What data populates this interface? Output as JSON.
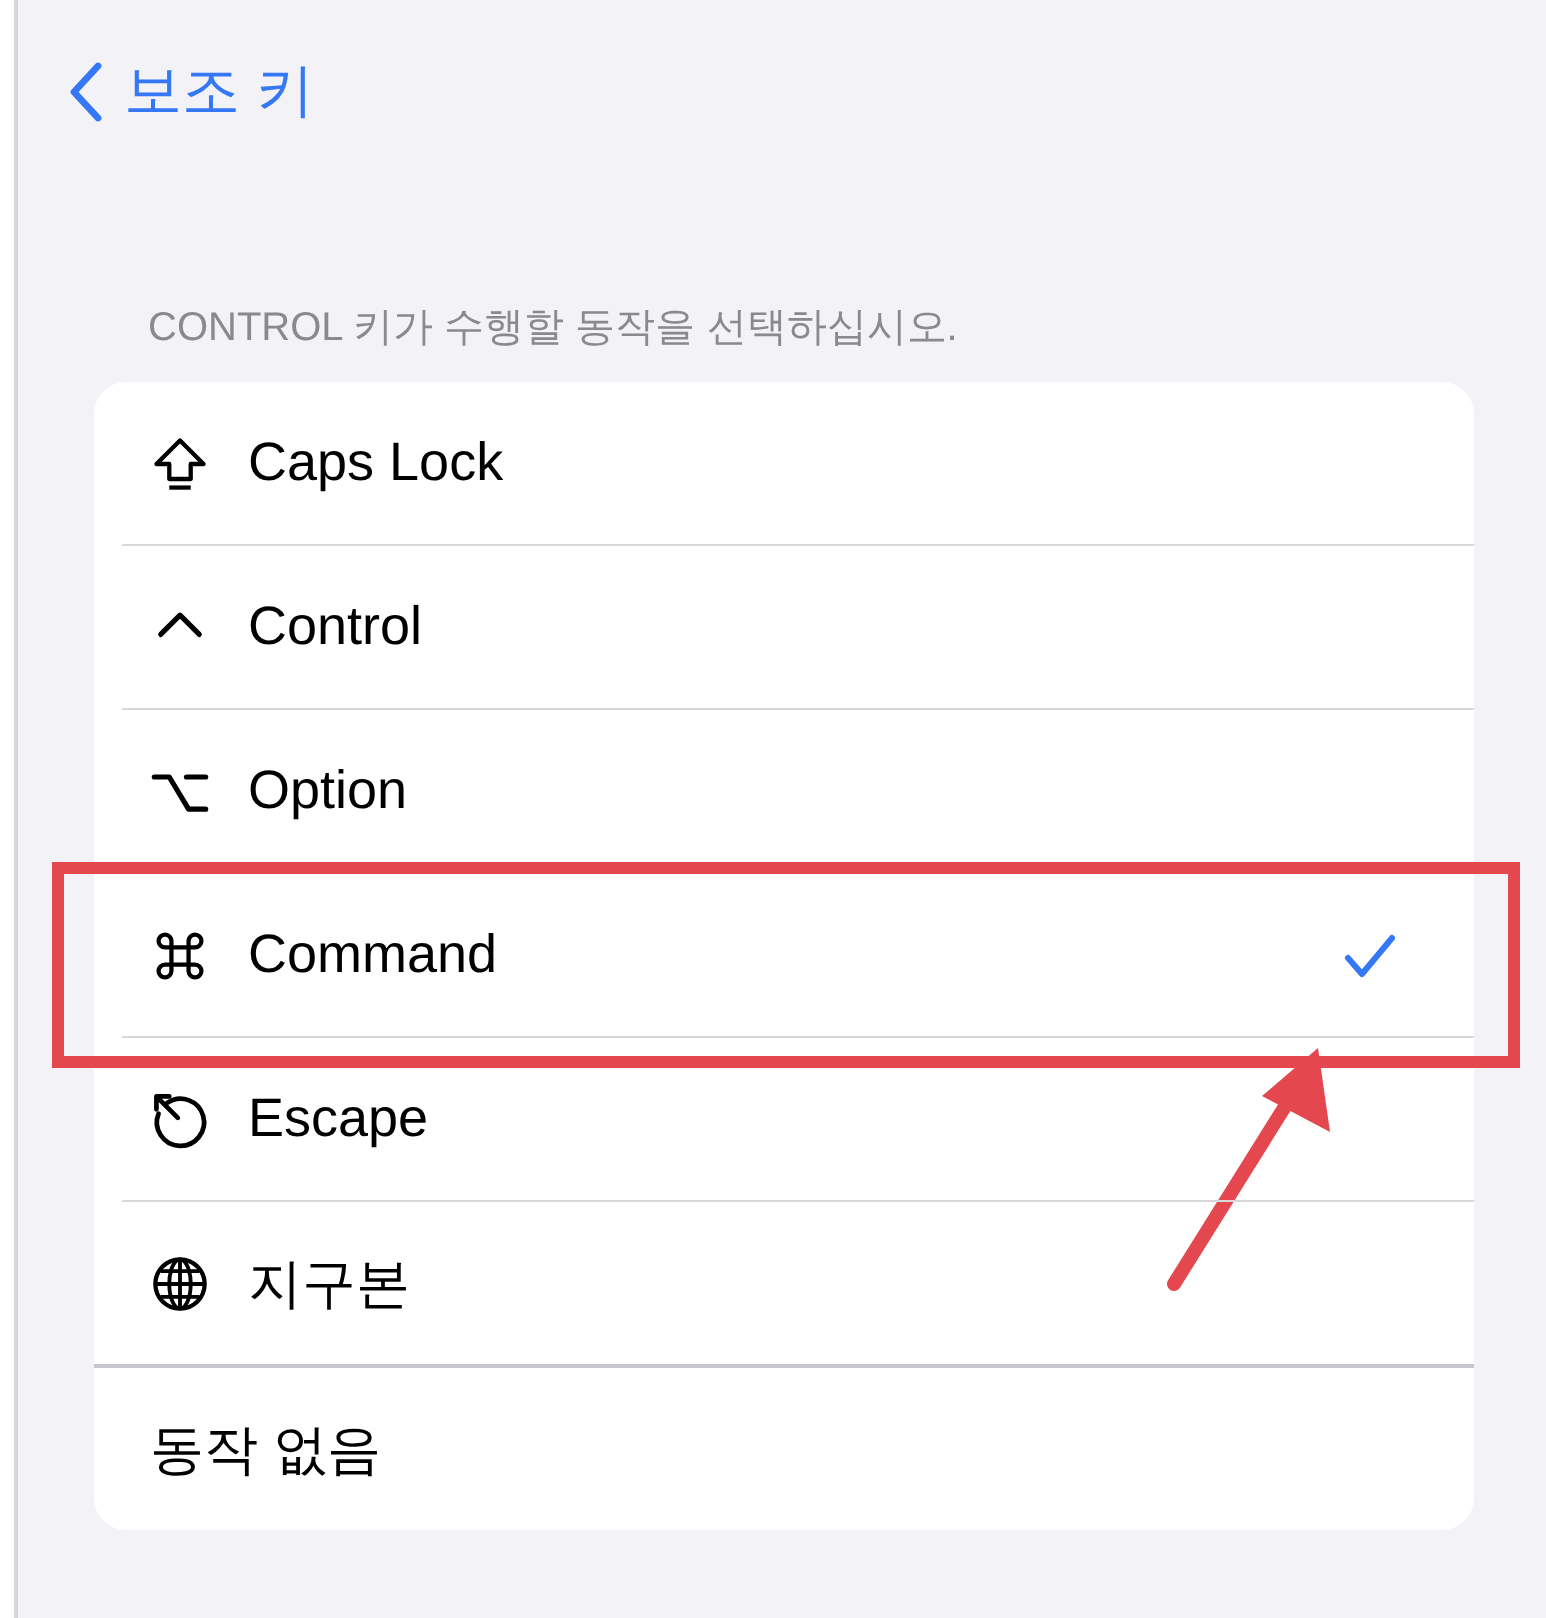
{
  "nav": {
    "back_label": "보조 키"
  },
  "section_header": "CONTROL 키가 수행할 동작을 선택하십시오.",
  "options": [
    {
      "label": "Caps Lock",
      "kind": "key",
      "selected": false,
      "highlighted": false
    },
    {
      "label": "Control",
      "kind": "key",
      "selected": false,
      "highlighted": false
    },
    {
      "label": "Option",
      "kind": "key",
      "selected": false,
      "highlighted": false
    },
    {
      "label": "Command",
      "kind": "key",
      "selected": true,
      "highlighted": true
    },
    {
      "label": "Escape",
      "kind": "key",
      "selected": false,
      "highlighted": false
    },
    {
      "label": "지구본",
      "kind": "key",
      "selected": false,
      "highlighted": false
    },
    {
      "label": "동작 없음",
      "kind": "plain",
      "selected": false,
      "highlighted": false
    }
  ]
}
